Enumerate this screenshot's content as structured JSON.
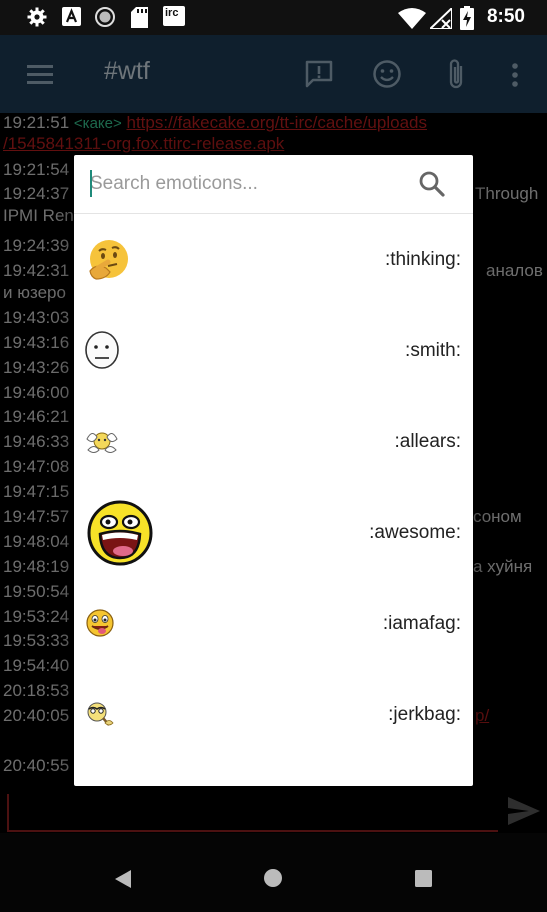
{
  "status_bar": {
    "time": "8:50",
    "icons": [
      "gear-icon",
      "font-a-icon",
      "record-icon",
      "sd-card-icon",
      "irc-icon",
      "wifi-icon",
      "no-signal-icon",
      "battery-charging-icon"
    ],
    "irc_label": "irc"
  },
  "app_bar": {
    "title": "#wtf",
    "icons": [
      "menu-icon",
      "alert-message-icon",
      "smiley-icon",
      "attach-icon",
      "more-vert-icon"
    ]
  },
  "chat": {
    "lines": [
      {
        "time": "19:21:51",
        "nick": "<каке>",
        "text": "https://fakecake.org/tt-irc/cache/uploads"
      },
      {
        "time": "",
        "nick": "",
        "text": "/1545841311-org.fox.ttirc-release.apk"
      },
      {
        "time": "19:21:54",
        "nick": "",
        "text": ""
      },
      {
        "time": "19:24:37",
        "nick": "",
        "text": "Through"
      },
      {
        "time": "",
        "nick": "",
        "text": "IPMI Ren"
      },
      {
        "time": "19:24:39",
        "nick": "",
        "text": ""
      },
      {
        "time": "19:42:31",
        "nick": "",
        "text": "аналов"
      },
      {
        "time": "",
        "nick": "",
        "text": "и юзеро"
      },
      {
        "time": "19:43:03",
        "nick": "",
        "text": ""
      },
      {
        "time": "19:43:16",
        "nick": "",
        "text": ""
      },
      {
        "time": "19:43:26",
        "nick": "",
        "text": ""
      },
      {
        "time": "19:46:00",
        "nick": "",
        "text": ""
      },
      {
        "time": "19:46:21",
        "nick": "",
        "text": ""
      },
      {
        "time": "19:46:33",
        "nick": "",
        "text": ""
      },
      {
        "time": "19:47:08",
        "nick": "",
        "text": ""
      },
      {
        "time": "19:47:15",
        "nick": "",
        "text": ""
      },
      {
        "time": "19:47:57",
        "nick": "",
        "text": "соном"
      },
      {
        "time": "19:48:04",
        "nick": "",
        "text": ""
      },
      {
        "time": "19:48:19",
        "nick": "",
        "text": "а хуйня"
      },
      {
        "time": "19:50:54",
        "nick": "",
        "text": ""
      },
      {
        "time": "19:53:24",
        "nick": "",
        "text": ""
      },
      {
        "time": "19:53:33",
        "nick": "",
        "text": ""
      },
      {
        "time": "19:54:40",
        "nick": "",
        "text": ""
      },
      {
        "time": "20:18:53",
        "nick": "",
        "text": ""
      },
      {
        "time": "20:40:05",
        "nick": "",
        "text": "p/"
      },
      {
        "time": "20:40:55",
        "nick": "",
        "text": ""
      }
    ]
  },
  "dialog": {
    "search_placeholder": "Search emoticons...",
    "emoticons": [
      {
        "code": ":thinking:",
        "icon": "thinking-face-icon"
      },
      {
        "code": ":smith:",
        "icon": "smith-face-icon"
      },
      {
        "code": ":allears:",
        "icon": "allears-icon"
      },
      {
        "code": ":awesome:",
        "icon": "awesome-face-icon"
      },
      {
        "code": ":iamafag:",
        "icon": "tongue-face-icon"
      },
      {
        "code": ":jerkbag:",
        "icon": "jerkbag-icon"
      }
    ]
  },
  "colors": {
    "app_bar": "#1c3a52",
    "nick": "#35c08c",
    "link": "#b21e1e",
    "accent": "#1f8a7a"
  }
}
